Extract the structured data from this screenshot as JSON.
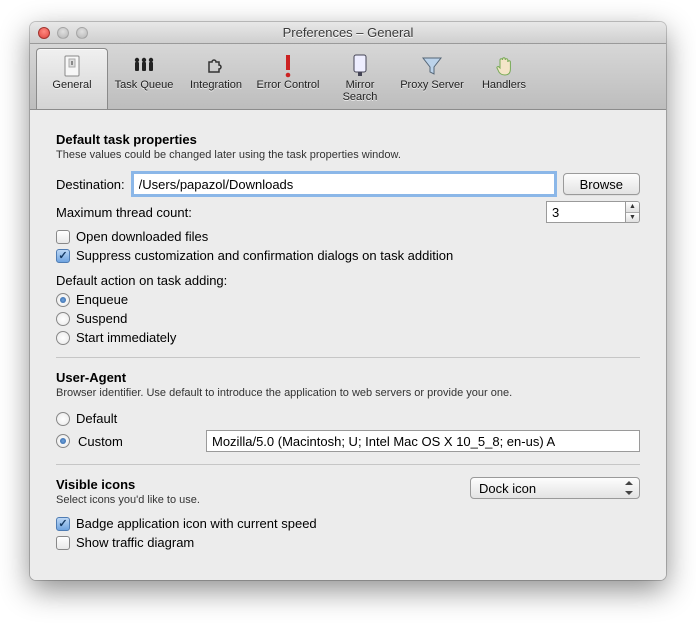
{
  "window": {
    "title": "Preferences – General"
  },
  "toolbar": {
    "items": [
      {
        "label": "General"
      },
      {
        "label": "Task Queue"
      },
      {
        "label": "Integration"
      },
      {
        "label": "Error Control"
      },
      {
        "label": "Mirror Search"
      },
      {
        "label": "Proxy Server"
      },
      {
        "label": "Handlers"
      }
    ]
  },
  "task": {
    "title": "Default task properties",
    "sub": "These values could be changed later using the task properties window.",
    "dest_label": "Destination:",
    "dest_value": "/Users/papazol/Downloads",
    "browse": "Browse",
    "maxthreads_label": "Maximum thread count:",
    "maxthreads_value": "3",
    "open_dl": "Open downloaded files",
    "suppress": "Suppress customization and confirmation dialogs on task addition",
    "action_label": "Default action on task adding:",
    "actions": {
      "enqueue": "Enqueue",
      "suspend": "Suspend",
      "start": "Start immediately"
    }
  },
  "ua": {
    "title": "User-Agent",
    "sub": "Browser identifier. Use default to introduce the application to web servers or provide your one.",
    "default": "Default",
    "custom": "Custom",
    "value": "Mozilla/5.0 (Macintosh; U; Intel Mac OS X 10_5_8; en-us) A"
  },
  "icons": {
    "title": "Visible icons",
    "sub": "Select icons you'd like to use.",
    "select": "Dock icon",
    "badge": "Badge application icon with current speed",
    "diagram": "Show traffic diagram"
  }
}
